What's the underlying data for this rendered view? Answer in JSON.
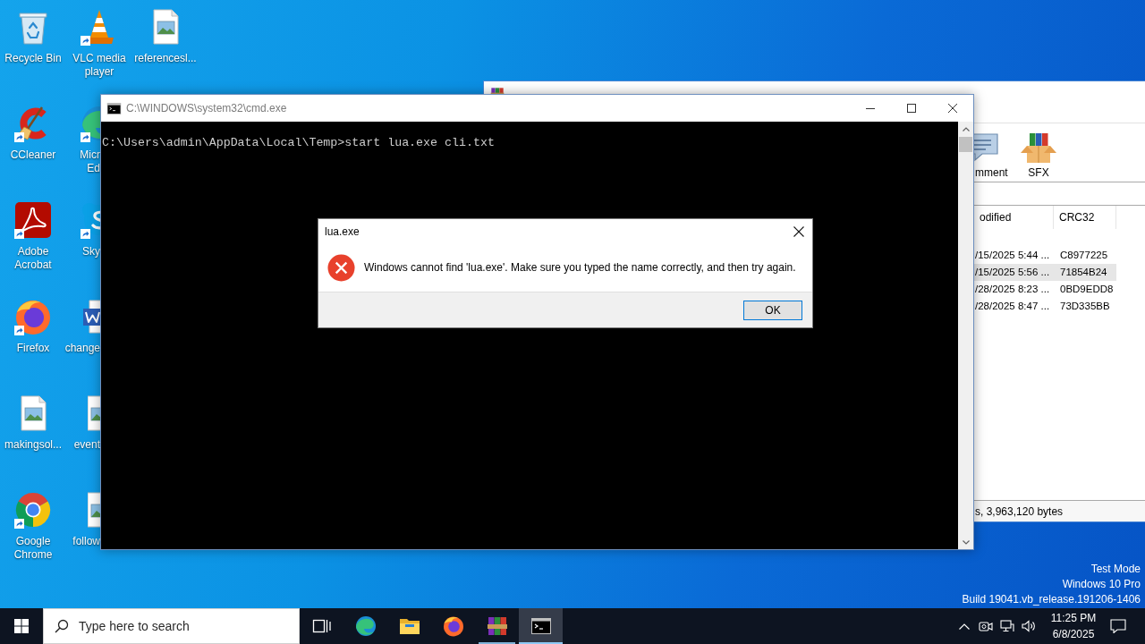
{
  "desktop": {
    "icon_columns": [
      {
        "icons": [
          {
            "kind": "recycle-bin",
            "label_lines": [
              "Recycle Bin"
            ],
            "shortcut": false
          },
          {
            "kind": "ccleaner",
            "label_lines": [
              "CCleaner"
            ],
            "shortcut": true
          },
          {
            "kind": "acrobat",
            "label_lines": [
              "Adobe",
              "Acrobat"
            ],
            "shortcut": true
          },
          {
            "kind": "firefox",
            "label_lines": [
              "Firefox"
            ],
            "shortcut": true
          },
          {
            "kind": "image-file",
            "label_lines": [
              "makingsol..."
            ],
            "shortcut": false
          },
          {
            "kind": "chrome",
            "label_lines": [
              "Google",
              "Chrome"
            ],
            "shortcut": true
          }
        ]
      },
      {
        "icons": [
          {
            "kind": "vlc",
            "label_lines": [
              "VLC media",
              "player"
            ],
            "shortcut": true
          },
          {
            "kind": "edge",
            "label_lines": [
              "Micr",
              "Ed"
            ],
            "shortcut": true
          },
          {
            "kind": "skype",
            "label_lines": [
              "Sky"
            ],
            "shortcut": true
          },
          {
            "kind": "word-document",
            "label_lines": [
              "change"
            ],
            "shortcut": false
          },
          {
            "kind": "image-file",
            "label_lines": [
              "event"
            ],
            "shortcut": false
          },
          {
            "kind": "image-file",
            "label_lines": [
              "follow"
            ],
            "shortcut": false
          }
        ]
      },
      {
        "icons": [
          {
            "kind": "image-file",
            "label_lines": [
              "referencesl..."
            ],
            "shortcut": false
          }
        ]
      }
    ],
    "edition_lines": [
      "Test Mode",
      "Windows 10 Pro",
      "Build 19041.vb_release.191206-1406"
    ]
  },
  "archive_window": {
    "toolbar": [
      {
        "kind": "comment",
        "label": "mment"
      },
      {
        "kind": "sfx",
        "label": "SFX"
      }
    ],
    "columns": [
      "odified",
      "CRC32"
    ],
    "rows": [
      {
        "cells": [
          "/15/2025 5:44 ...",
          "C8977225"
        ],
        "selected": false
      },
      {
        "cells": [
          "/15/2025 5:56 ...",
          "71854B24"
        ],
        "selected": true
      },
      {
        "cells": [
          "/28/2025 8:23 ...",
          "0BD9EDD8"
        ],
        "selected": false
      },
      {
        "cells": [
          "/28/2025 8:47 ...",
          "73D335BB"
        ],
        "selected": false
      }
    ],
    "status": "s, 3,963,120 bytes"
  },
  "console_window": {
    "title": "C:\\WINDOWS\\system32\\cmd.exe",
    "lines": [
      "C:\\Users\\admin\\AppData\\Local\\Temp>start lua.exe cli.txt"
    ]
  },
  "dialog": {
    "title": "lua.exe",
    "kind": "error",
    "message": "Windows cannot find 'lua.exe'. Make sure you typed the name correctly, and then try again.",
    "buttons": [
      {
        "label": "OK",
        "default": true
      }
    ]
  },
  "taskbar": {
    "search": {
      "placeholder": "Type here to search"
    },
    "apps": [
      {
        "kind": "task-view",
        "running": false,
        "selected": false
      },
      {
        "kind": "edge",
        "running": false,
        "selected": false
      },
      {
        "kind": "explorer",
        "running": false,
        "selected": false
      },
      {
        "kind": "firefox",
        "running": false,
        "selected": false
      },
      {
        "kind": "winrar",
        "running": true,
        "selected": false
      },
      {
        "kind": "cmd",
        "running": true,
        "selected": true
      }
    ],
    "clock": {
      "time": "11:25 PM",
      "date": "6/8/2025"
    }
  }
}
